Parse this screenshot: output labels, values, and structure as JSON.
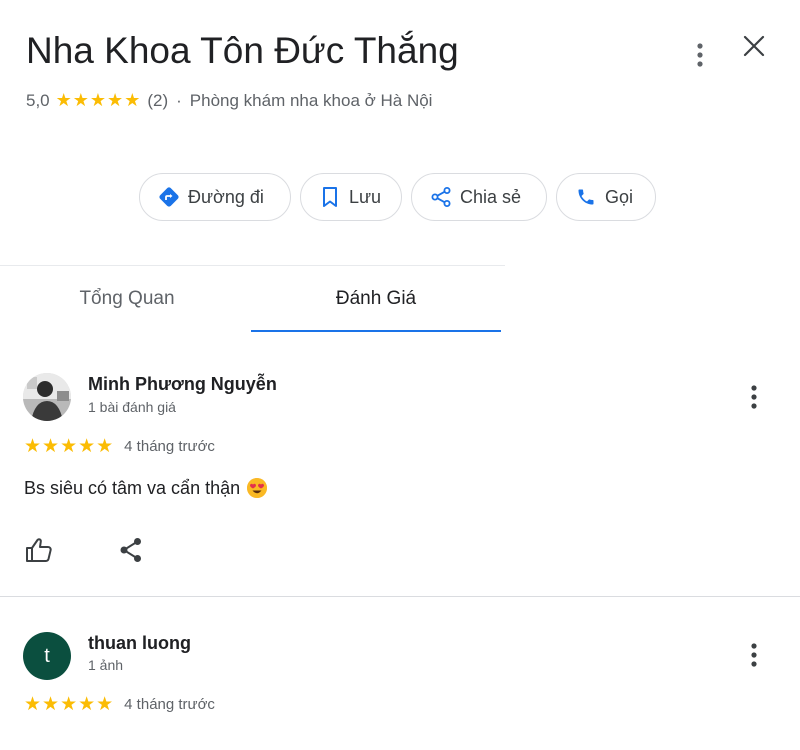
{
  "place": {
    "title": "Nha Khoa Tôn Đức Thắng",
    "rating": "5,0",
    "stars": "★★★★★",
    "review_count": "(2)",
    "separator": "·",
    "category": "Phòng khám nha khoa ở Hà Nội"
  },
  "actions": {
    "directions_label": "Đường đi",
    "save_label": "Lưu",
    "share_label": "Chia sẻ",
    "call_label": "Gọi"
  },
  "tabs": [
    {
      "label": "Tổng Quan",
      "active": false
    },
    {
      "label": "Đánh Giá",
      "active": true
    }
  ],
  "reviews": [
    {
      "author": "Minh Phương Nguyễn",
      "meta": "1 bài đánh giá",
      "stars": "★★★★★",
      "rating_value": 5,
      "time": "4 tháng trước",
      "text": "Bs siêu có tâm va cẩn thận"
    },
    {
      "author": "thuan luong",
      "avatar_letter": "t",
      "meta": "1 ảnh",
      "stars": "★★★★★",
      "rating_value": 5,
      "time": "4 tháng trước"
    }
  ],
  "colors": {
    "accent": "#1a73e8",
    "star": "#fbbc04",
    "avatar_bg": "#0b4f3f"
  },
  "icons": {
    "directions": "directions-icon",
    "save": "bookmark-icon",
    "share": "share-icon",
    "call": "phone-icon",
    "more": "more-vert-icon",
    "close": "close-icon",
    "like": "thumbs-up-icon"
  }
}
